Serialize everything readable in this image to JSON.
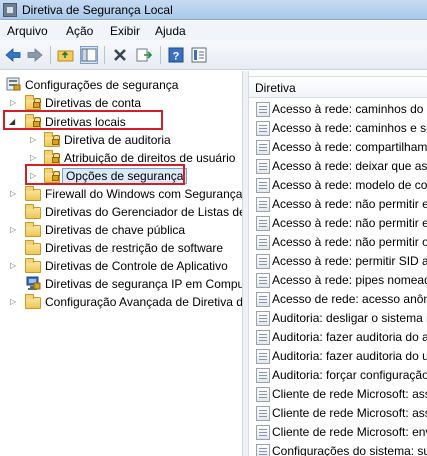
{
  "window": {
    "title": "Diretiva de Segurança Local"
  },
  "menu": [
    "Arquivo",
    "Ação",
    "Exibir",
    "Ajuda"
  ],
  "toolbar": {
    "buttons": [
      "back-arrow-icon",
      "forward-arrow-icon",
      "up-folder-icon",
      "show-tree-icon",
      "delete-icon",
      "export-list-icon",
      "help-icon",
      "properties-icon"
    ]
  },
  "tree": {
    "root": "Configurações de segurança",
    "items": [
      {
        "label": "Diretivas de conta"
      },
      {
        "label": "Diretivas locais"
      },
      {
        "label": "Diretiva de auditoria"
      },
      {
        "label": "Atribuição de direitos de usuário"
      },
      {
        "label": "Opções de segurança"
      },
      {
        "label": "Firewall do Windows com Segurança"
      },
      {
        "label": "Diretivas do Gerenciador de Listas de"
      },
      {
        "label": "Diretivas de chave pública"
      },
      {
        "label": "Diretivas de restrição de software"
      },
      {
        "label": "Diretivas de Controle de Aplicativo"
      },
      {
        "label": "Diretivas de segurança IP em Comput"
      },
      {
        "label": "Configuração Avançada de Diretiva d"
      }
    ]
  },
  "policies": {
    "column_header": "Diretiva",
    "rows": [
      "Acesso à rede: caminhos do R",
      "Acesso à rede: caminhos e sul",
      "Acesso à rede: compartilhame",
      "Acesso à rede: deixar que as p",
      "Acesso à rede: modelo de con",
      "Acesso à rede: não permitir er",
      "Acesso à rede: não permitir er",
      "Acesso à rede: não permitir o",
      "Acesso à rede: permitir SID an",
      "Acesso à rede: pipes nomeado",
      "Acesso de rede: acesso anôni",
      "Auditoria: desligar o sistema i",
      "Auditoria: fazer auditoria do a",
      "Auditoria: fazer auditoria do u",
      "Auditoria: forçar configuração",
      "Cliente de rede Microsoft: ass",
      "Cliente de rede Microsoft: ass",
      "Cliente de rede Microsoft: env",
      "Configurações do sistema: su"
    ]
  }
}
